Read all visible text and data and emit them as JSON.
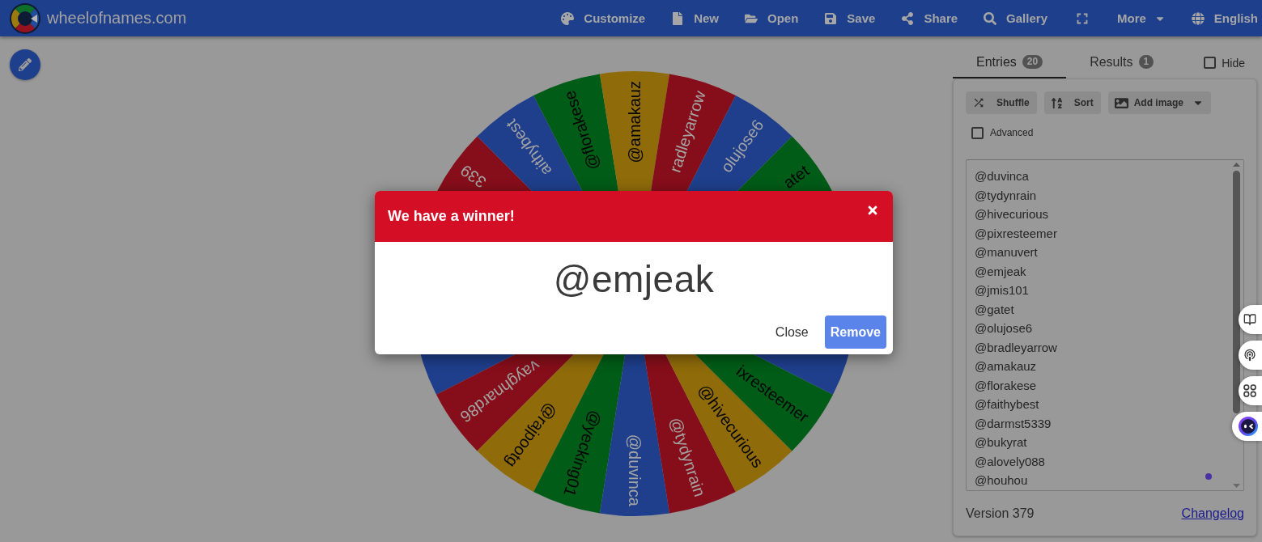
{
  "top_bar": {
    "site_name": "wheelofnames.com",
    "menu": [
      {
        "kind": "item",
        "label": "Customize"
      },
      {
        "kind": "item",
        "label": "New"
      },
      {
        "kind": "item",
        "label": "Open"
      },
      {
        "kind": "item",
        "label": "Save"
      },
      {
        "kind": "item",
        "label": "Share"
      },
      {
        "kind": "item",
        "label": "Gallery"
      },
      {
        "kind": "icon"
      },
      {
        "kind": "dropdown",
        "label": "More"
      },
      {
        "kind": "item",
        "label": "English"
      }
    ]
  },
  "wheel": {
    "upper_segments": [
      {
        "label": "339",
        "color": "#860e1a"
      },
      {
        "label": "aithybest",
        "color": "#1f3f8c"
      },
      {
        "label": "@florakese",
        "color": "#005c17"
      },
      {
        "label": "@amakauz",
        "color": "#8f6b0a"
      },
      {
        "label": "radleyarrow",
        "color": "#860e1a"
      },
      {
        "label": "olujose6",
        "color": "#1f3f8c"
      },
      {
        "label": "atet",
        "color": "#005c17"
      }
    ],
    "lower_segments": [
      {
        "color": "#1f3f8c"
      },
      {
        "label": "vayghnard86",
        "color": "#860e1a"
      },
      {
        "label": "@rajpootg",
        "color": "#8f6b0a"
      },
      {
        "label": "@yecking01",
        "color": "#005c17"
      },
      {
        "label": "@duvinca",
        "color": "#1f3f8c"
      },
      {
        "label": "@tydynrain",
        "color": "#860e1a"
      },
      {
        "label": "@hivecurious",
        "color": "#8f6b0a"
      },
      {
        "label": "ixresteemer",
        "color": "#005c17"
      },
      {
        "color": "#1f3f8c"
      }
    ]
  },
  "panel": {
    "tabs": [
      {
        "label": "Entries",
        "count": "20",
        "selected": true
      },
      {
        "label": "Results",
        "count": "1",
        "selected": false
      }
    ],
    "hide": {
      "label": "Hide",
      "checked": false
    },
    "toolbar": [
      {
        "kind": "button",
        "label": "Shuffle"
      },
      {
        "kind": "button",
        "label": "Sort"
      },
      {
        "kind": "dropdown",
        "label": "Add image"
      }
    ],
    "advanced": {
      "label": "Advanced",
      "checked": false
    },
    "entries": [
      "@duvinca",
      "@tydynrain",
      "@hivecurious",
      "@pixresteemer",
      "@manuvert",
      "@emjeak",
      "@jmis101",
      "@gatet",
      "@olujose6",
      "@bradleyarrow",
      "@amakauz",
      "@florakese",
      "@faithybest",
      "@darmst5339",
      "@bukyrat",
      "@alovely088",
      "@houhou"
    ],
    "version": "Version 379",
    "changelog": "Changelog"
  },
  "dialog": {
    "title": "We have a winner!",
    "winner": "@emjeak",
    "buttons": [
      {
        "kind": "text",
        "label": "Close"
      },
      {
        "kind": "primary",
        "label": "Remove"
      }
    ]
  }
}
